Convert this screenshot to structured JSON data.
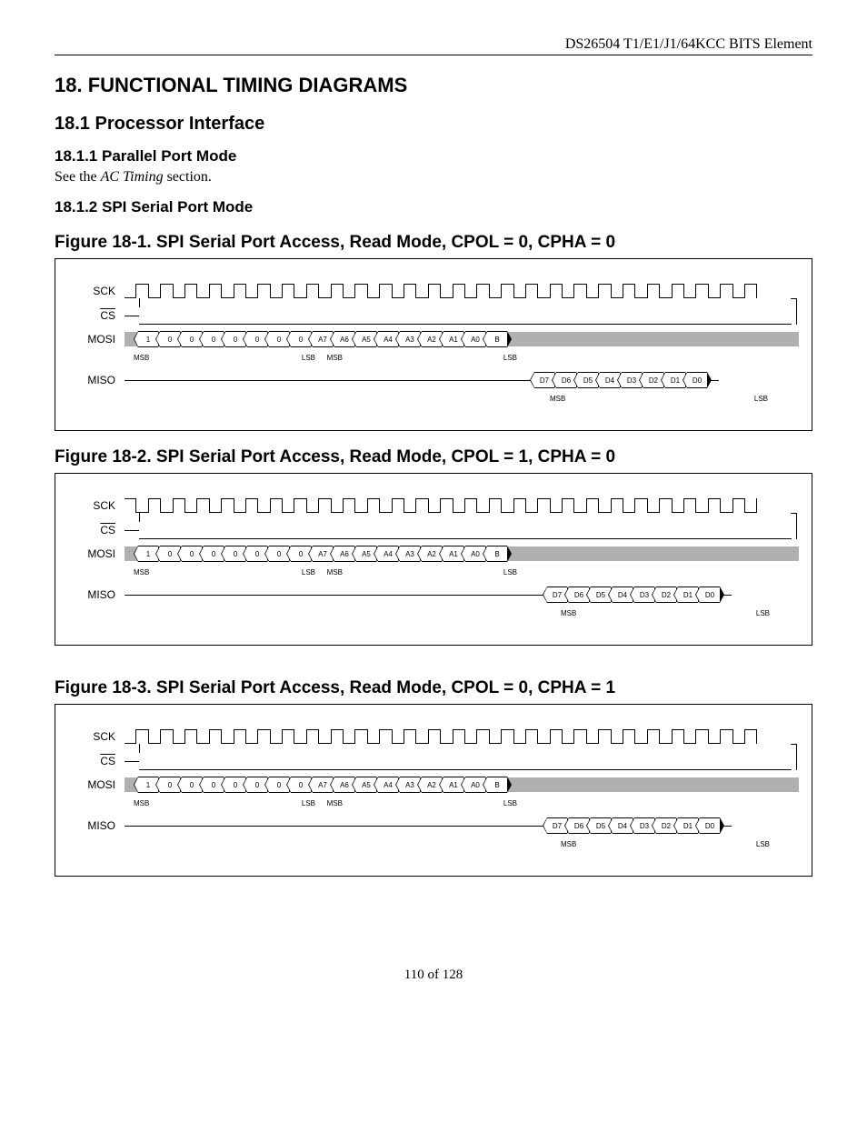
{
  "header": "DS26504 T1/E1/J1/64KCC BITS Element",
  "s18": "18.  FUNCTIONAL TIMING DIAGRAMS",
  "s18_1": "18.1  Processor Interface",
  "s18_1_1": "18.1.1  Parallel Port Mode",
  "body1_a": "See the ",
  "body1_b": "AC Timing",
  "body1_c": " section.",
  "s18_1_2": "18.1.2  SPI Serial Port Mode",
  "fig1": "Figure 18-1. SPI Serial Port Access, Read Mode, CPOL = 0, CPHA = 0",
  "fig2": "Figure 18-2. SPI Serial Port Access, Read Mode, CPOL = 1, CPHA = 0",
  "fig3": "Figure 18-3. SPI Serial Port Access, Read Mode, CPOL = 0, CPHA = 1",
  "signals": {
    "sck": "SCK",
    "cs": "CS",
    "mosi": "MOSI",
    "miso": "MISO"
  },
  "labels": {
    "msb": "MSB",
    "lsb": "LSB"
  },
  "mosi_bits": [
    "1",
    "0",
    "0",
    "0",
    "0",
    "0",
    "0",
    "0",
    "A7",
    "A6",
    "A5",
    "A4",
    "A3",
    "A2",
    "A1",
    "A0",
    "B"
  ],
  "miso_bits": [
    "D7",
    "D6",
    "D5",
    "D4",
    "D3",
    "D2",
    "D1",
    "D0"
  ],
  "footer": "110 of 128",
  "chart_data": [
    {
      "type": "timing",
      "title": "SPI Serial Port Access, Read Mode, CPOL = 0, CPHA = 0",
      "cpol": 0,
      "cpha": 0,
      "sck": {
        "idle": "low",
        "cycles": 26
      },
      "cs": {
        "before": "high",
        "during": "low",
        "after": "high"
      },
      "mosi": {
        "sequence": [
          "1",
          "0",
          "0",
          "0",
          "0",
          "0",
          "0",
          "0",
          "A7",
          "A6",
          "A5",
          "A4",
          "A3",
          "A2",
          "A1",
          "A0",
          "B"
        ],
        "byte0_msb_first": true,
        "byte1_msb_first": true,
        "after": "idle-gray"
      },
      "miso": {
        "before": "hi-z-line",
        "sequence": [
          "D7",
          "D6",
          "D5",
          "D4",
          "D3",
          "D2",
          "D1",
          "D0"
        ],
        "msb_first": true
      }
    },
    {
      "type": "timing",
      "title": "SPI Serial Port Access, Read Mode, CPOL = 1, CPHA = 0",
      "cpol": 1,
      "cpha": 0,
      "sck": {
        "idle": "high",
        "cycles": 26
      },
      "cs": {
        "before": "high",
        "during": "low",
        "after": "high"
      },
      "mosi": {
        "sequence": [
          "1",
          "0",
          "0",
          "0",
          "0",
          "0",
          "0",
          "0",
          "A7",
          "A6",
          "A5",
          "A4",
          "A3",
          "A2",
          "A1",
          "A0",
          "B"
        ],
        "byte0_msb_first": true,
        "byte1_msb_first": true,
        "after": "idle-gray"
      },
      "miso": {
        "before": "hi-z-line",
        "sequence": [
          "D7",
          "D6",
          "D5",
          "D4",
          "D3",
          "D2",
          "D1",
          "D0"
        ],
        "msb_first": true
      }
    },
    {
      "type": "timing",
      "title": "SPI Serial Port Access, Read Mode, CPOL = 0, CPHA = 1",
      "cpol": 0,
      "cpha": 1,
      "sck": {
        "idle": "low",
        "cycles": 26
      },
      "cs": {
        "before": "high",
        "during": "low",
        "after": "high"
      },
      "mosi": {
        "sequence": [
          "1",
          "0",
          "0",
          "0",
          "0",
          "0",
          "0",
          "0",
          "A7",
          "A6",
          "A5",
          "A4",
          "A3",
          "A2",
          "A1",
          "A0",
          "B"
        ],
        "byte0_msb_first": true,
        "byte1_msb_first": true,
        "after": "idle-gray"
      },
      "miso": {
        "before": "hi-z-line",
        "sequence": [
          "D7",
          "D6",
          "D5",
          "D4",
          "D3",
          "D2",
          "D1",
          "D0"
        ],
        "msb_first": true
      }
    }
  ]
}
